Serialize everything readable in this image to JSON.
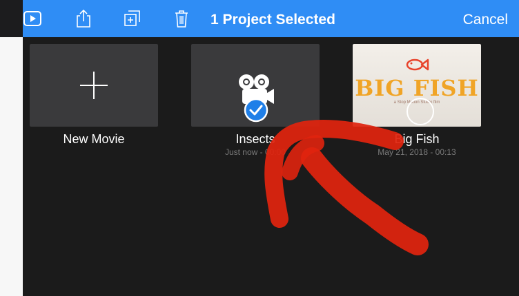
{
  "toolbar": {
    "title": "1 Project Selected",
    "cancel_label": "Cancel",
    "icons": [
      "play-icon",
      "share-icon",
      "duplicate-icon",
      "trash-icon"
    ]
  },
  "projects": [
    {
      "name": "New Movie",
      "meta": ""
    },
    {
      "name": "Insects",
      "meta": "Just now - 00:00",
      "selected": true
    },
    {
      "name": "Big Fish",
      "meta": "May 21, 2018 - 00:13",
      "poster_title": "BIG FISH",
      "poster_subtitle": "a Stop Motion Studio film"
    }
  ],
  "colors": {
    "accent": "#2f8df5",
    "annotation": "#e0230e"
  }
}
